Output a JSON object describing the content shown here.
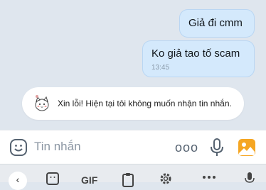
{
  "messages": [
    {
      "text": "Giả đi cmm"
    },
    {
      "text": "Ko giả tao tố scam",
      "time": "13:45"
    }
  ],
  "system_notice": {
    "text": "Xin lỗi! Hiện tại tôi không muốn nhận tin nhắn.",
    "icon": "cat-sticker-icon"
  },
  "composer": {
    "placeholder": "Tin nhắn",
    "more_label": "ooo"
  },
  "keyboard_toolbar": {
    "back_label": "‹",
    "gif_label": "GIF"
  },
  "colors": {
    "chat_bg": "#dfe6ee",
    "outgoing_bubble": "#d4e9fc",
    "gallery_icon": "#f5a623"
  }
}
